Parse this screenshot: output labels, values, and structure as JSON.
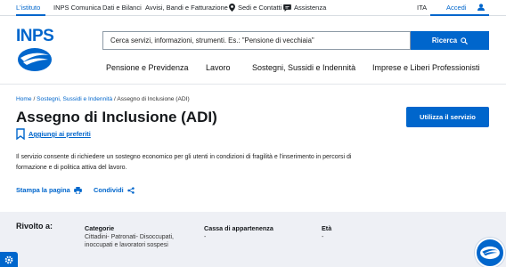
{
  "topbar": {
    "items": [
      {
        "label": "L'istituto",
        "active": true
      },
      {
        "label": "INPS Comunica"
      },
      {
        "label": "Dati e Bilanci"
      },
      {
        "label": "Avvisi, Bandi e Fatturazione"
      },
      {
        "label": "Sedi e Contatti",
        "icon": "location-icon"
      },
      {
        "label": "Assistenza",
        "icon": "chat-icon"
      }
    ],
    "language": "ITA",
    "login": "Accedi"
  },
  "header": {
    "logo": "INPS",
    "search_placeholder": "Cerca servizi, informazioni, strumenti. Es.: \"Pensione di vecchiaia\"",
    "search_button": "Ricerca"
  },
  "nav": [
    "Pensione e Previdenza",
    "Lavoro",
    "Sostegni, Sussidi e Indennità",
    "Imprese e Liberi Professionisti"
  ],
  "breadcrumb": {
    "home": "Home",
    "section": "Sostegni, Sussidi e Indennità",
    "current": "Assegno di Inclusione (ADI)",
    "separator": "/"
  },
  "page": {
    "title": "Assegno di Inclusione (ADI)",
    "cta": "Utilizza il servizio",
    "favorite": "Aggiungi ai preferiti",
    "description_line1": "Il servizio consente di richiedere un sostegno economico per gli utenti in condizioni di fragilità e l'inserimento in percorsi di",
    "description_line2": "formazione e di politica attiva del lavoro.",
    "print": "Stampa la pagina",
    "share": "Condividi"
  },
  "audience": {
    "heading": "Rivolto a:",
    "categories_label": "Categorie",
    "categories_line1": "Cittadini- Patronati- Disoccupati,",
    "categories_line2": "inoccupati e lavoratori sospesi",
    "fund_label": "Cassa di appartenenza",
    "fund_value": "-",
    "age_label": "Età",
    "age_value": "-"
  },
  "colors": {
    "primary": "#0066cc",
    "band": "#eef0f5",
    "text": "#15181b"
  }
}
